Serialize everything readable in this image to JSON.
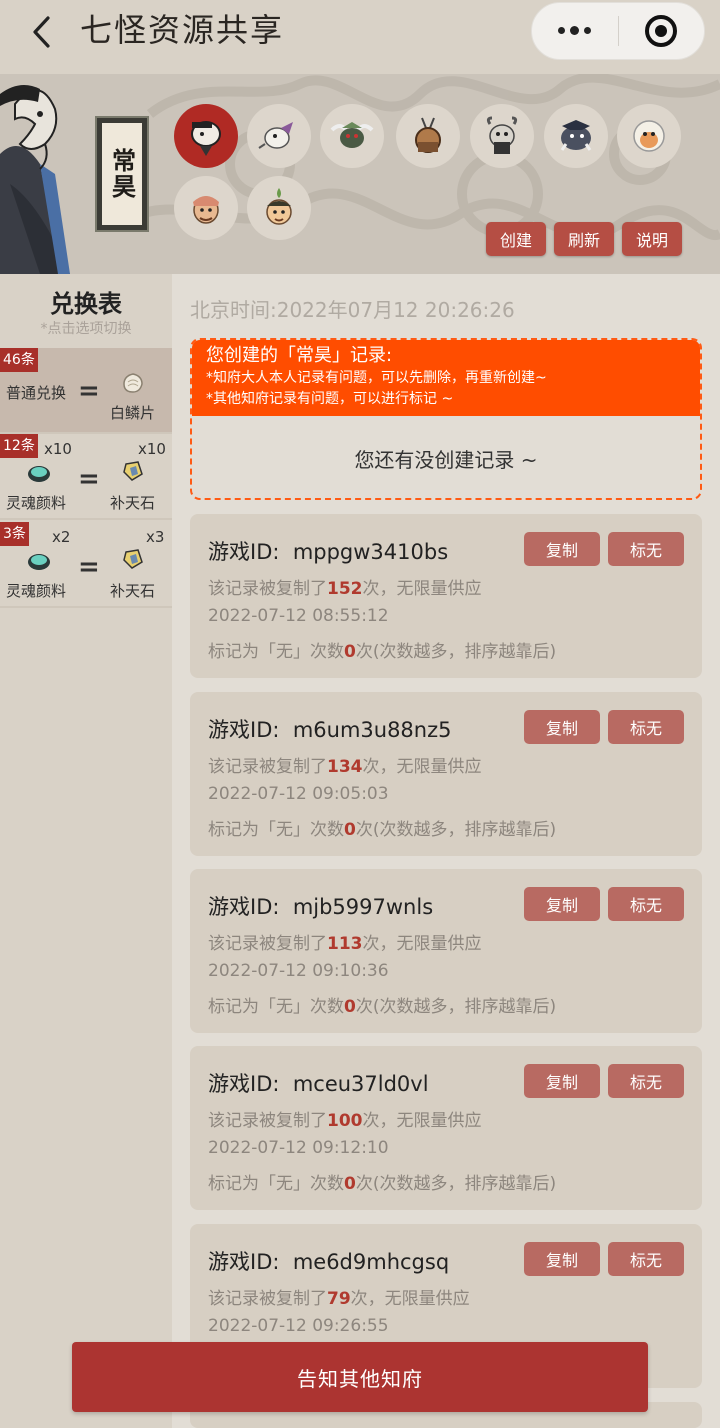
{
  "nav": {
    "title": "七怪资源共享"
  },
  "banner": {
    "name_tag": "常昊",
    "avatars": [
      "avatar-1",
      "avatar-2",
      "avatar-3",
      "avatar-4",
      "avatar-5",
      "avatar-6",
      "avatar-7",
      "avatar-8",
      "avatar-9"
    ],
    "buttons": {
      "create": "创建",
      "refresh": "刷新",
      "help": "说明"
    }
  },
  "sidebar": {
    "title": "兑换表",
    "hint": "*点击选项切换",
    "items": [
      {
        "count": "46条",
        "left_label": "普通兑换",
        "right_label": "白鳞片",
        "left_mult": "",
        "right_mult": ""
      },
      {
        "count": "12条",
        "left_label": "灵魂颜料",
        "right_label": "补天石",
        "left_mult": "x10",
        "right_mult": "x10"
      },
      {
        "count": "3条",
        "left_label": "灵魂颜料",
        "right_label": "补天石",
        "left_mult": "x2",
        "right_mult": "x3"
      }
    ],
    "eq": "="
  },
  "main": {
    "time": "北京时间:2022年07月12 20:26:26",
    "my_records": {
      "heading": "您创建的「常昊」记录:",
      "note1": "*知府大人本人记录有问题，可以先删除，再重新创建~",
      "note2": "*其他知府记录有问题，可以进行标记 ~",
      "empty": "您还有没创建记录 ~"
    },
    "copy_label": "复制",
    "mark_label": "标无",
    "records": [
      {
        "id_prefix": "游戏ID:",
        "id": "mppgw3410bs",
        "copied_pre": "该记录被复制了",
        "copied": "152",
        "copied_post": "次，无限量供应",
        "date": "2022-07-12 08:55:12",
        "mark_pre": "标记为「无」次数",
        "marks": "0",
        "mark_post": "次(次数越多，排序越靠后)"
      },
      {
        "id_prefix": "游戏ID:",
        "id": "m6um3u88nz5",
        "copied_pre": "该记录被复制了",
        "copied": "134",
        "copied_post": "次，无限量供应",
        "date": "2022-07-12 09:05:03",
        "mark_pre": "标记为「无」次数",
        "marks": "0",
        "mark_post": "次(次数越多，排序越靠后)"
      },
      {
        "id_prefix": "游戏ID:",
        "id": "mjb5997wnls",
        "copied_pre": "该记录被复制了",
        "copied": "113",
        "copied_post": "次，无限量供应",
        "date": "2022-07-12 09:10:36",
        "mark_pre": "标记为「无」次数",
        "marks": "0",
        "mark_post": "次(次数越多，排序越靠后)"
      },
      {
        "id_prefix": "游戏ID:",
        "id": "mceu37ld0vl",
        "copied_pre": "该记录被复制了",
        "copied": "100",
        "copied_post": "次，无限量供应",
        "date": "2022-07-12 09:12:10",
        "mark_pre": "标记为「无」次数",
        "marks": "0",
        "mark_post": "次(次数越多，排序越靠后)"
      },
      {
        "id_prefix": "游戏ID:",
        "id": "me6d9mhcgsq",
        "copied_pre": "该记录被复制了",
        "copied": "79",
        "copied_post": "次，无限量供应",
        "date": "2022-07-12 09:26:55",
        "mark_pre": "",
        "marks": "",
        "mark_post": ""
      }
    ]
  },
  "footer": {
    "notify": "告知其他知府"
  },
  "colors": {
    "accent": "#ac3431",
    "orange": "#ff4d00",
    "count_red": "#b03a2e",
    "bg": "#d9d2c7"
  }
}
